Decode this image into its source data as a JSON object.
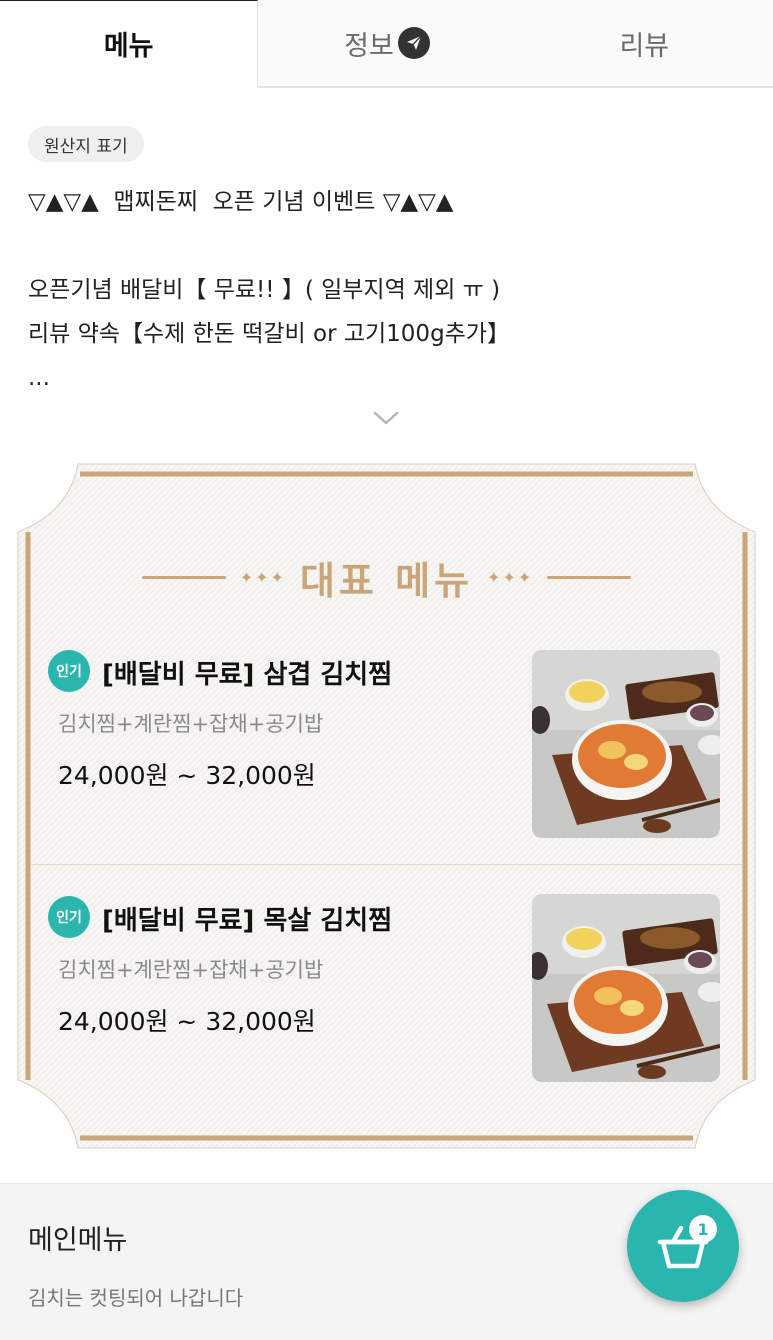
{
  "tabs": [
    {
      "label": "메뉴",
      "active": true
    },
    {
      "label": "정보",
      "active": false,
      "icon": "send-icon"
    },
    {
      "label": "리뷰",
      "active": false
    }
  ],
  "notice": {
    "origin_chip": "원산지 표기",
    "lines": [
      "▽▲▽▲  맵찌돈찌  오픈 기념 이벤트 ▽▲▽▲",
      "",
      "오픈기념 배달비【 무료!! 】( 일부지역 제외 ㅠ )",
      "리뷰 약속【수제 한돈 떡갈비 or 고기100g추가】",
      "..."
    ],
    "expand_icon": "chevron-down-icon"
  },
  "featured": {
    "title": "대표 메뉴",
    "ornament": "✦✦✦",
    "accent_color": "#c9a57a",
    "items": [
      {
        "badge": "인기",
        "name": "[배달비 무료] 삼겹 김치찜",
        "description": "김치찜+계란찜+잡채+공기밥",
        "price": "24,000원 ~ 32,000원"
      },
      {
        "badge": "인기",
        "name": "[배달비 무료] 목살 김치찜",
        "description": "김치찜+계란찜+잡채+공기밥",
        "price": "24,000원 ~ 32,000원"
      }
    ]
  },
  "category": {
    "title": "메인메뉴",
    "description": "김치는 컷팅되어 나갑니다"
  },
  "cart": {
    "count": "1",
    "icon": "basket-icon",
    "color": "#2ab6ae"
  }
}
